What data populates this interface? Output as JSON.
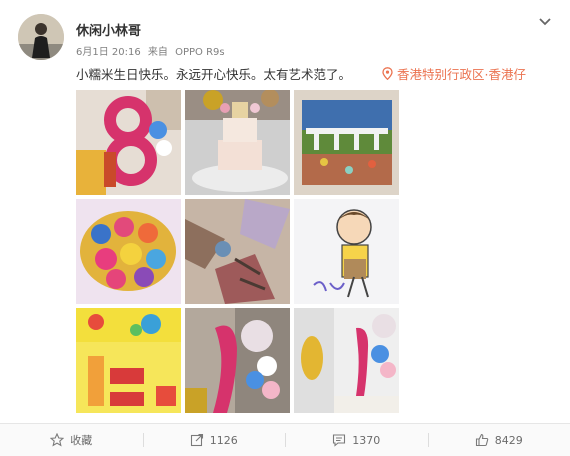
{
  "user": {
    "name": "休闲小林哥"
  },
  "meta": {
    "date": "6月1日 20:16",
    "source_prefix": "来自",
    "device": "OPPO R9s"
  },
  "post": {
    "text": "小糯米生日快乐。永远开心快乐。太有艺术范了。"
  },
  "location": {
    "name": "香港特别行政区·香港仔"
  },
  "actions": {
    "favorite_label": "收藏",
    "repost_count": "1126",
    "comment_count": "1370",
    "like_count": "8429"
  },
  "colors": {
    "accent": "#eb7350",
    "text": "#333333",
    "meta": "#808080"
  }
}
